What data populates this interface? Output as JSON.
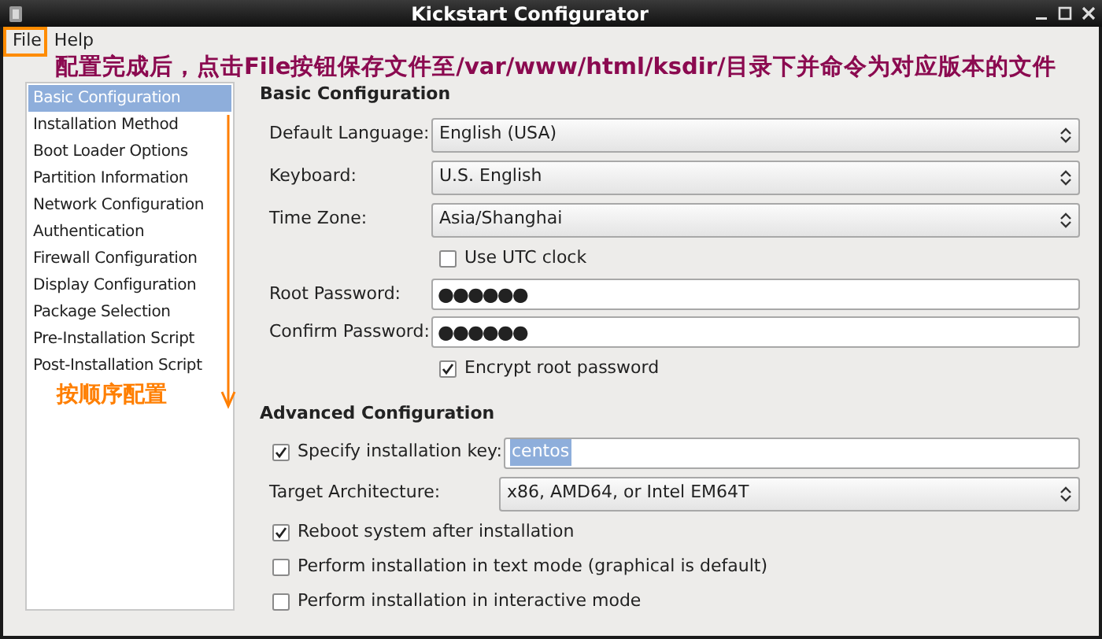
{
  "window": {
    "title": "Kickstart Configurator"
  },
  "menu": [
    {
      "label": "File"
    },
    {
      "label": "Help"
    }
  ],
  "annotations": {
    "note": "配置完成后，点击File按钮保存文件至/var/www/html/ksdir/目录下并命令为对应版本的文件",
    "order_note": "按顺序配置"
  },
  "sidebar": {
    "items": [
      {
        "label": "Basic Configuration",
        "selected": true
      },
      {
        "label": "Installation Method",
        "selected": false
      },
      {
        "label": "Boot Loader Options",
        "selected": false
      },
      {
        "label": "Partition Information",
        "selected": false
      },
      {
        "label": "Network Configuration",
        "selected": false
      },
      {
        "label": "Authentication",
        "selected": false
      },
      {
        "label": "Firewall Configuration",
        "selected": false
      },
      {
        "label": "Display Configuration",
        "selected": false
      },
      {
        "label": "Package Selection",
        "selected": false
      },
      {
        "label": "Pre-Installation Script",
        "selected": false
      },
      {
        "label": "Post-Installation Script",
        "selected": false
      }
    ]
  },
  "basic": {
    "heading": "Basic Configuration",
    "fields": [
      {
        "kind": "select",
        "label": "Default Language:",
        "value": "English (USA)"
      },
      {
        "kind": "select",
        "label": "Keyboard:",
        "value": "U.S. English"
      },
      {
        "kind": "select",
        "label": "Time Zone:",
        "value": "Asia/Shanghai"
      },
      {
        "kind": "checkbox",
        "label": "Use UTC clock",
        "checked": false
      },
      {
        "kind": "password",
        "label": "Root Password:",
        "value": "●●●●●●"
      },
      {
        "kind": "password",
        "label": "Confirm Password:",
        "value": "●●●●●●"
      },
      {
        "kind": "checkbox",
        "label": "Encrypt root password",
        "checked": true
      }
    ]
  },
  "advanced": {
    "heading": "Advanced Configuration",
    "fields": [
      {
        "kind": "checkbox_text",
        "label": "Specify installation key:",
        "checked": true,
        "value": "centos",
        "text_selected": true
      },
      {
        "kind": "select",
        "label": "Target Architecture:",
        "value": "x86, AMD64, or Intel EM64T"
      },
      {
        "kind": "checkbox",
        "label": "Reboot system after installation",
        "checked": true
      },
      {
        "kind": "checkbox",
        "label": "Perform installation in text mode (graphical is default)",
        "checked": false
      },
      {
        "kind": "checkbox",
        "label": "Perform installation in interactive mode",
        "checked": false
      }
    ]
  }
}
